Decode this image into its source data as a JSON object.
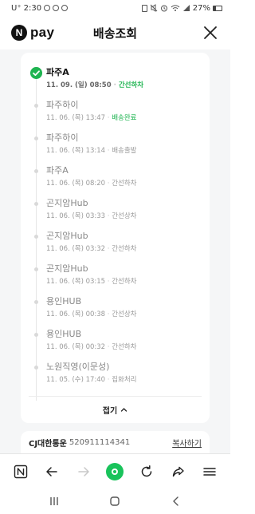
{
  "status_bar": {
    "carrier": "U⁺",
    "time": "2:30",
    "battery": "27%"
  },
  "header": {
    "brand_logo": "N",
    "brand_text": "pay",
    "title": "배송조회"
  },
  "tracking": {
    "steps": [
      {
        "location": "파주A",
        "date": "11. 09. (일) 08:50",
        "status": "간선하차",
        "current": true
      },
      {
        "location": "파주하이",
        "date": "11. 06. (목) 13:47",
        "status": "배송완료",
        "highlight": true
      },
      {
        "location": "파주하이",
        "date": "11. 06. (목) 13:14",
        "status": "배송출발"
      },
      {
        "location": "파주A",
        "date": "11. 06. (목) 08:20",
        "status": "간선하차"
      },
      {
        "location": "곤지암Hub",
        "date": "11. 06. (목) 03:33",
        "status": "간선상차"
      },
      {
        "location": "곤지암Hub",
        "date": "11. 06. (목) 03:32",
        "status": "간선하차"
      },
      {
        "location": "곤지암Hub",
        "date": "11. 06. (목) 03:15",
        "status": "간선하차"
      },
      {
        "location": "용인HUB",
        "date": "11. 06. (목) 00:38",
        "status": "간선상차"
      },
      {
        "location": "용인HUB",
        "date": "11. 06. (목) 00:32",
        "status": "간선하차"
      },
      {
        "location": "노원직영(이문성)",
        "date": "11. 05. (수) 17:40",
        "status": "집화처리"
      }
    ],
    "fold_label": "접기"
  },
  "carrier": {
    "name": "CJ대한통운",
    "tracking_number": "520911114341",
    "copy_label": "복사하기"
  },
  "colors": {
    "accent_green": "#1fb451",
    "browser_green": "#19c35b"
  }
}
